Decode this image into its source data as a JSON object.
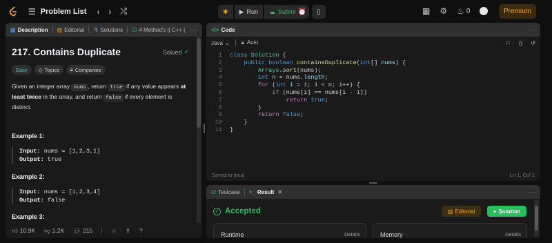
{
  "topbar": {
    "problem_list": "Problem List",
    "run_label": "Run",
    "submit_label": "Submit",
    "streak_count": "0",
    "premium_label": "Premium"
  },
  "left_panel": {
    "tabs": [
      "Description",
      "Editorial",
      "Solutions",
      "4 Method's || C++ |"
    ],
    "title": "217. Contains Duplicate",
    "status": "Solved",
    "pills": [
      "Easy",
      "Topics",
      "Companies"
    ],
    "desc": {
      "p1": "Given an integer array ",
      "c1": "nums",
      "p2": ", return ",
      "c2": "true",
      "p3": " if any value appears ",
      "b1": "at least twice",
      "p4": " in the array, and return ",
      "c3": "false",
      "p5": " if every element is distinct."
    },
    "examples": [
      {
        "title": "Example 1:",
        "input_label": "Input:",
        "input": "nums = [1,2,3,1]",
        "output_label": "Output:",
        "output": "true"
      },
      {
        "title": "Example 2:",
        "input_label": "Input:",
        "input": "nums = [1,2,3,4]",
        "output_label": "Output:",
        "output": "false"
      },
      {
        "title": "Example 3:"
      }
    ],
    "footer": {
      "likes": "10.9K",
      "dislikes": "1.2K",
      "comments": "215"
    }
  },
  "code_panel": {
    "title": "Code",
    "language": "Java",
    "mode": "Auto",
    "lines": [
      "1",
      "2",
      "3",
      "4",
      "5",
      "6",
      "7",
      "8",
      "9",
      "10",
      "11"
    ],
    "saved": "Saved to local",
    "cursor": "Ln 1, Col 1"
  },
  "result_panel": {
    "tabs": [
      "Testcase",
      "Result"
    ],
    "status": "Accepted",
    "editorial_btn": "Editorial",
    "solution_btn": "Solution",
    "card1": "Runtime",
    "card2": "Memory",
    "details": "Details"
  },
  "colors": {
    "accent": "#ffa116",
    "success": "#2cbb5d",
    "easy": "#46c6c2"
  }
}
